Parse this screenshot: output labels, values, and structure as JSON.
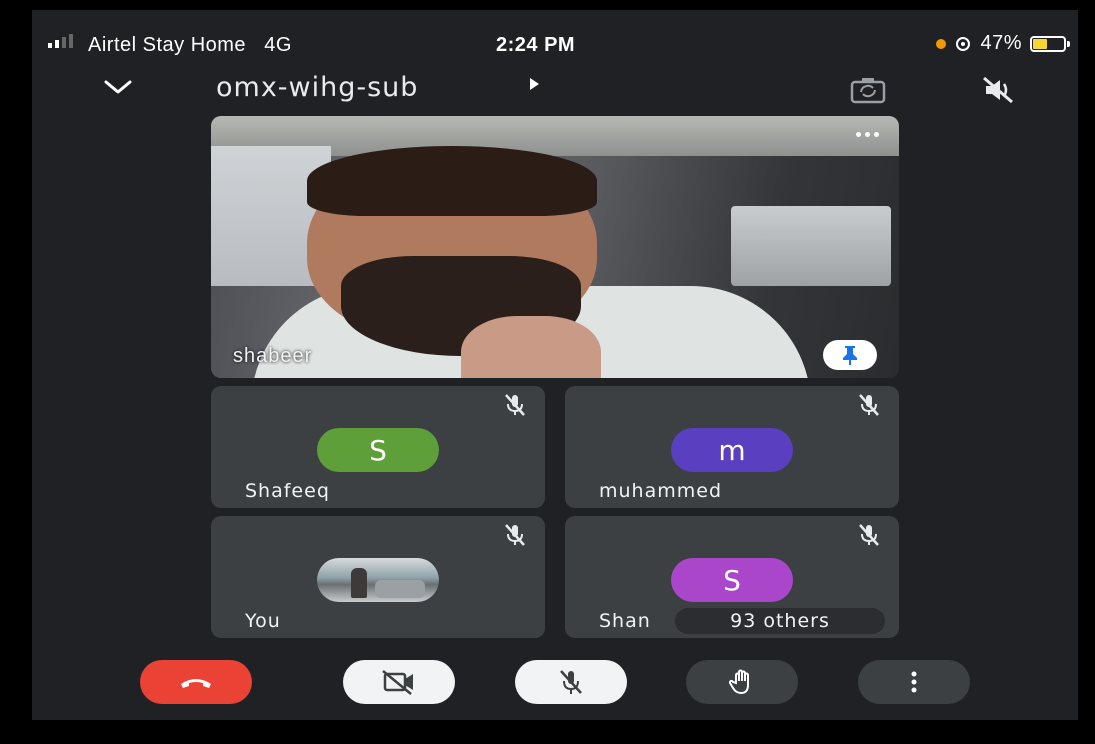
{
  "status_bar": {
    "carrier": "Airtel Stay Home",
    "network": "4G",
    "time": "2:24 PM",
    "battery": "47%"
  },
  "header": {
    "meeting_code": "omx-wihg-sub"
  },
  "main_tile": {
    "name": "shabeer"
  },
  "participants": [
    {
      "name": "Shafeeq",
      "initial": "S",
      "color": "#5e9f3a",
      "muted": true
    },
    {
      "name": "muhammed",
      "initial": "m",
      "color": "#5a3fc0",
      "muted": true
    },
    {
      "name": "You",
      "initial": "",
      "color": "",
      "muted": true
    },
    {
      "name": "Shan",
      "initial": "S",
      "color": "#a946c9",
      "muted": true
    }
  ],
  "others_label": "93 others",
  "controls": {
    "end_call": "end-call",
    "camera": "camera-off",
    "mic": "mic-off",
    "raise_hand": "raise-hand",
    "more": "more-options"
  },
  "colors": {
    "background": "#202124",
    "tile": "#3c4043",
    "end_call": "#ea4335",
    "accent_blue": "#1a73e8"
  }
}
